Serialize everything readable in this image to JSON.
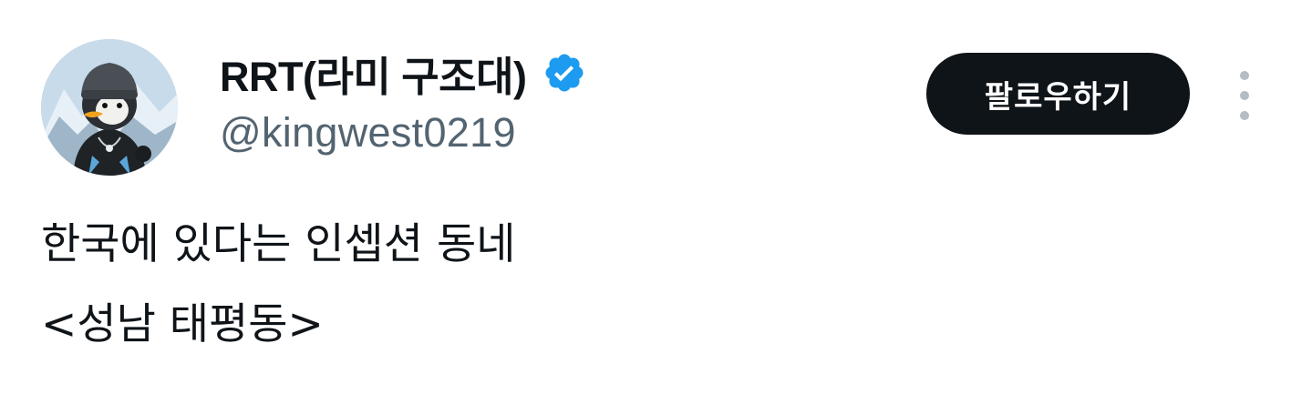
{
  "tweet": {
    "author": {
      "display_name": "RRT(라미 구조대)",
      "handle": "@kingwest0219",
      "verified": true,
      "avatar_icon": "penguin-avatar-icon"
    },
    "follow_label": "팔로우하기",
    "more_icon": "more-vertical-icon",
    "text_lines": [
      "한국에 있다는 인셉션 동네",
      "<성남 태평동>"
    ]
  },
  "colors": {
    "text_primary": "#0f1419",
    "text_secondary": "#536471",
    "verified_blue": "#1d9bf0",
    "follow_bg": "#0f1419",
    "follow_text": "#ffffff",
    "more_dots": "#b5bcc2"
  }
}
